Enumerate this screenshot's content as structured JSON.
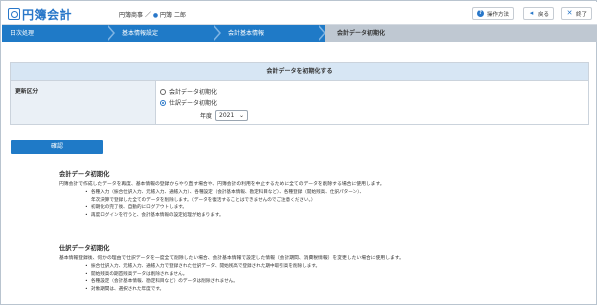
{
  "header": {
    "logo_text": "円簿会計",
    "company": "円簿商事",
    "user": "円簿 二郎",
    "help_label": "操作方法",
    "back_label": "戻る",
    "exit_label": "終了"
  },
  "steps": [
    {
      "label": "日次処理"
    },
    {
      "label": "基本情報設定"
    },
    {
      "label": "会計基本情報"
    },
    {
      "label": "会計データ初期化"
    }
  ],
  "panel": {
    "title": "会計データを初期化する",
    "field_label": "更新区分",
    "options": [
      {
        "label": "会計データ初期化",
        "selected": false
      },
      {
        "label": "仕訳データ初期化",
        "selected": true
      }
    ],
    "year_label": "年度",
    "year_value": "2021"
  },
  "confirm_label": "確認",
  "sections": [
    {
      "title": "会計データ初期化",
      "intro": "円簿会計で作成したデータを再度、基本情報の登録からやり直す場合や、円簿会計の利用を中止するために全てのデータを削除する場合に使用します。",
      "items": [
        "各種入力（振合仕訳入力、元帳入力、通帳入力）、各種設定（会計基本情報、勘定科目など）、各種登録（開始残高、仕訳パターン）、",
        "年次決算で登録した全てのデータを削除します。（データを復活することはできませんのでご注意ください。）",
        "初期化の完了後、自動的にログアウトします。",
        "再度ログインを行うと、会計基本情報の設定処理が始まります。"
      ]
    },
    {
      "title": "仕訳データ初期化",
      "intro": "基本情報登録後、何かの理由で仕訳データを一度全て削除したい場合、会計基本情報で設定した情報（会計期間、消費税情報）を変更したい場合に使用します。",
      "items": [
        "振合仕訳入力、元帳入力、通帳入力で登録された仕訳データ、開始残高で登録された期中取引高を削除します。",
        "開始残高の期首残高データは削除されません。",
        "各種設定（会計基本情報、勘定科目など）のデータは削除されません。",
        "対象期間は、選択された年度です。"
      ]
    }
  ],
  "colors": {
    "brand": "#2877c9",
    "nav": "#1f7ac7",
    "active_step": "#bfc8d2",
    "panel_title_bg": "#d7e6f4"
  }
}
